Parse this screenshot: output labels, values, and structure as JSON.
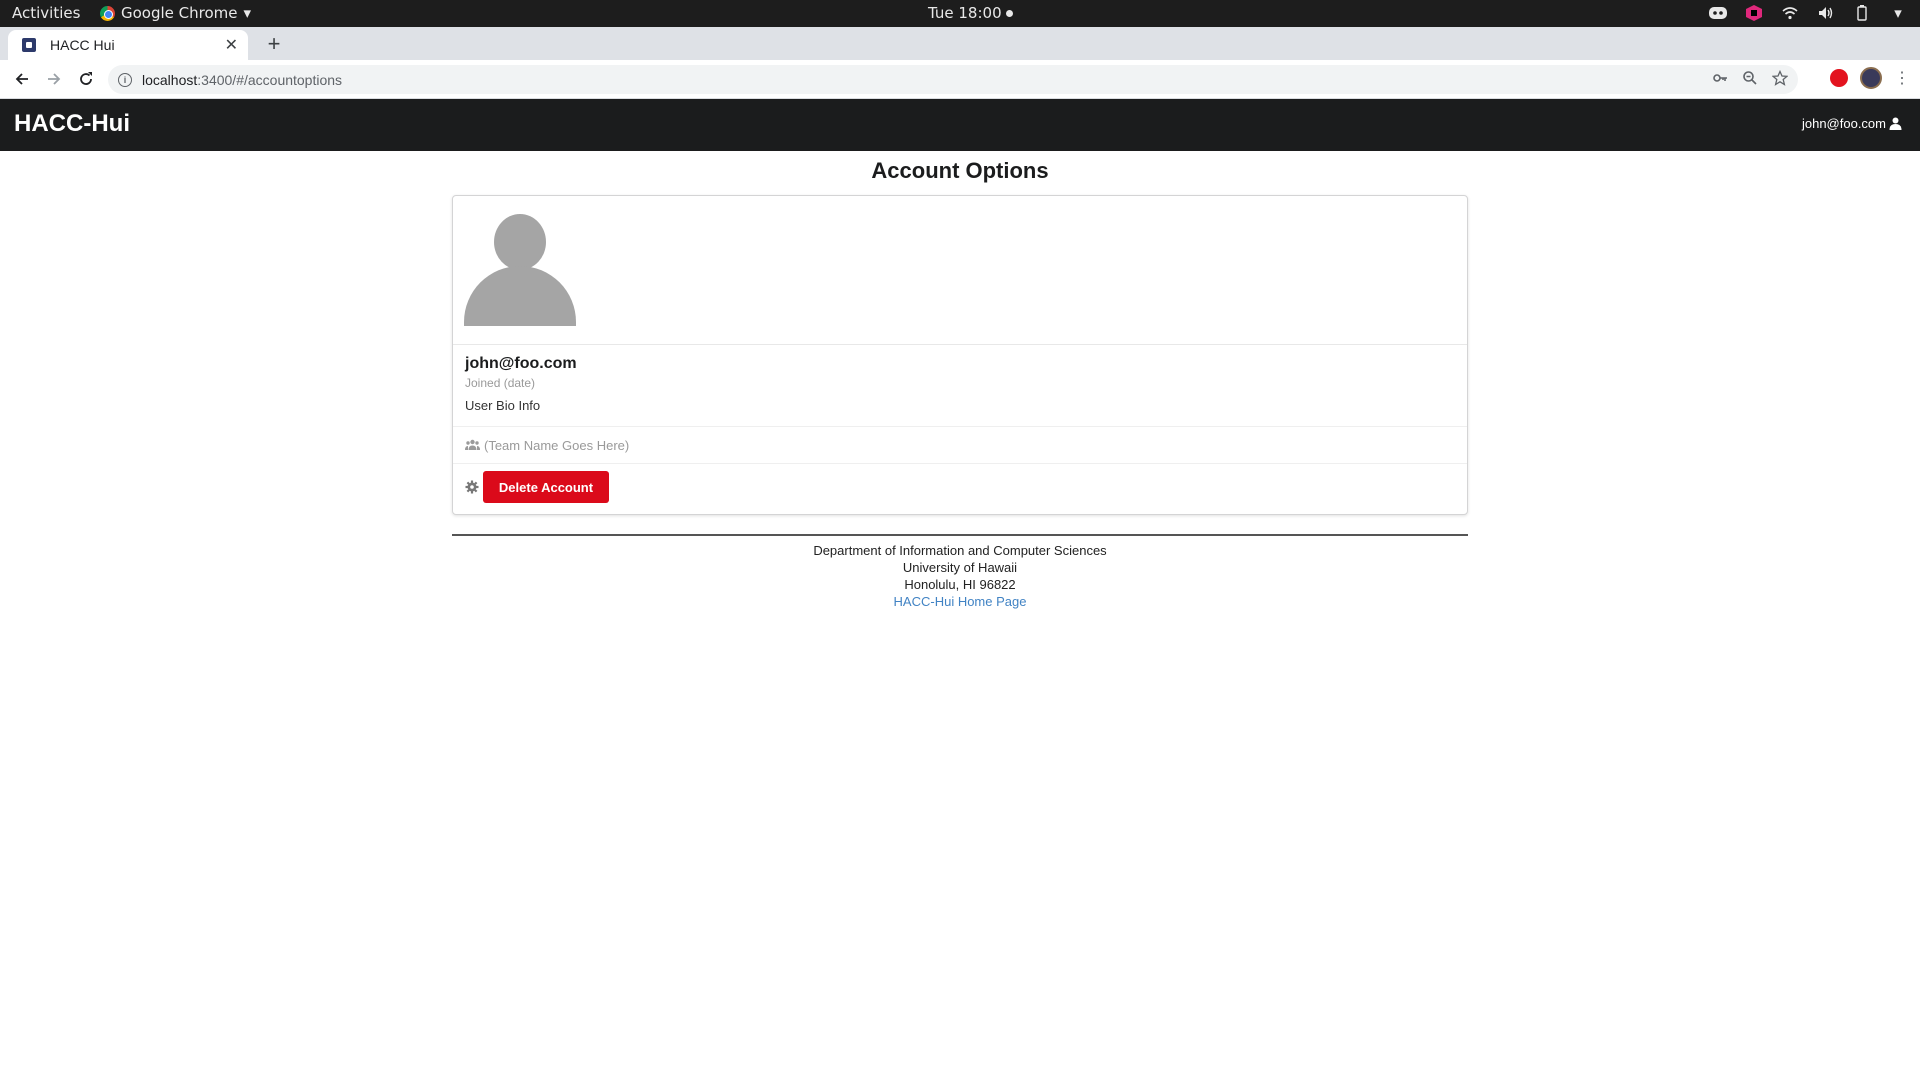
{
  "os_bar": {
    "activities": "Activities",
    "app_name": "Google Chrome",
    "clock": "Tue 18:00"
  },
  "browser": {
    "tab_title": "HACC Hui",
    "url_host": "localhost",
    "url_rest": ":3400/#/accountoptions"
  },
  "app": {
    "brand": "HACC-Hui",
    "user_email": "john@foo.com"
  },
  "page": {
    "title": "Account Options"
  },
  "profile_card": {
    "email": "john@foo.com",
    "joined": "Joined (date)",
    "bio": "User Bio Info",
    "team": "(Team Name Goes Here)",
    "delete_label": "Delete Account"
  },
  "footer": {
    "line1": "Department of Information and Computer Sciences",
    "line2": "University of Hawaii",
    "line3": "Honolulu, HI 96822",
    "link": "HACC-Hui Home Page"
  },
  "colors": {
    "navbar": "#1b1c1d",
    "delete_button": "#db0a1a",
    "link": "#4183c4"
  }
}
